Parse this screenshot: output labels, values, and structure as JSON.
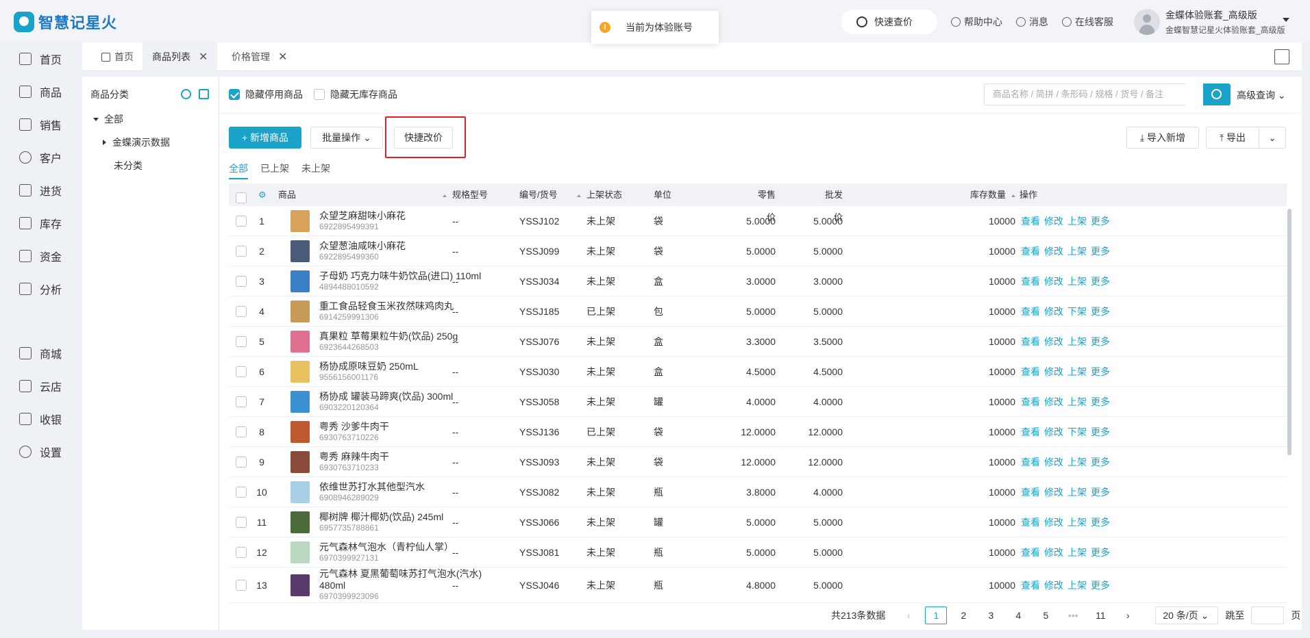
{
  "app": {
    "name": "智慧记星火"
  },
  "toast": {
    "text": "当前为体验账号",
    "icon": "warning-icon"
  },
  "topbar": {
    "quick_price": "快速查价",
    "help": "帮助中心",
    "messages": "消息",
    "service": "在线客服",
    "user_name": "金蝶体验账套_高级版",
    "user_sub": "金蝶智慧记星火体验账套_高级版"
  },
  "nav": [
    {
      "label": "首页",
      "icon": "home-icon"
    },
    {
      "label": "商品",
      "icon": "goods-icon"
    },
    {
      "label": "销售",
      "icon": "sales-icon"
    },
    {
      "label": "客户",
      "icon": "customer-icon"
    },
    {
      "label": "进货",
      "icon": "purchase-icon"
    },
    {
      "label": "库存",
      "icon": "inventory-icon"
    },
    {
      "label": "资金",
      "icon": "funds-icon"
    },
    {
      "label": "分析",
      "icon": "analysis-icon"
    },
    {
      "label": "商城",
      "icon": "mall-icon"
    },
    {
      "label": "云店",
      "icon": "cloud-store-icon"
    },
    {
      "label": "收银",
      "icon": "cashier-icon"
    },
    {
      "label": "设置",
      "icon": "settings-icon"
    }
  ],
  "tabs": [
    {
      "label": "首页"
    },
    {
      "label": "商品列表"
    },
    {
      "label": "价格管理"
    }
  ],
  "category": {
    "title": "商品分类",
    "all": "全部",
    "demo": "金蝶演示数据",
    "uncategorized": "未分类"
  },
  "filters": {
    "hide_disabled": "隐藏停用商品",
    "hide_no_stock": "隐藏无库存商品",
    "search_placeholder": "商品名称 / 简拼 / 条形码 / 规格 / 货号 / 备注",
    "advanced": "高级查询"
  },
  "toolbar": {
    "add": "+ 新增商品",
    "batch": "批量操作",
    "quick_edit": "快捷改价",
    "import": "导入新增",
    "export": "导出"
  },
  "subtabs": [
    "全部",
    "已上架",
    "未上架"
  ],
  "columns": {
    "product": "商品",
    "spec": "规格型号",
    "code": "编号/货号",
    "status": "上架状态",
    "unit": "单位",
    "retail": "零售价",
    "wholesale": "批发价",
    "stock": "库存数量",
    "ops": "操作"
  },
  "ops_labels": [
    "查看",
    "修改",
    "更多"
  ],
  "rows": [
    {
      "no": "1",
      "name": "众望芝麻甜味小麻花",
      "barcode": "6922895499391",
      "spec": "--",
      "code": "YSSJ102",
      "status": "未上架",
      "unit": "袋",
      "retail": "5.0000",
      "wholesale": "5.0000",
      "stock": "10000",
      "shelf_op": "上架",
      "color": "#d8a25a"
    },
    {
      "no": "2",
      "name": "众望葱油咸味小麻花",
      "barcode": "6922895499360",
      "spec": "--",
      "code": "YSSJ099",
      "status": "未上架",
      "unit": "袋",
      "retail": "5.0000",
      "wholesale": "5.0000",
      "stock": "10000",
      "shelf_op": "上架",
      "color": "#4a5a7a"
    },
    {
      "no": "3",
      "name": "子母奶 巧克力味牛奶饮品(进口) 110ml",
      "barcode": "4894488010592",
      "spec": "--",
      "code": "YSSJ034",
      "status": "未上架",
      "unit": "盒",
      "retail": "3.0000",
      "wholesale": "3.0000",
      "stock": "10000",
      "shelf_op": "上架",
      "color": "#3a7fc8"
    },
    {
      "no": "4",
      "name": "重工食品轻食玉米孜然味鸡肉丸",
      "barcode": "6914259991306",
      "spec": "--",
      "code": "YSSJ185",
      "status": "已上架",
      "unit": "包",
      "retail": "5.0000",
      "wholesale": "5.0000",
      "stock": "10000",
      "shelf_op": "下架",
      "color": "#c89a58"
    },
    {
      "no": "5",
      "name": "真果粒 草莓果粒牛奶(饮品) 250g",
      "barcode": "6923644268503",
      "spec": "--",
      "code": "YSSJ076",
      "status": "未上架",
      "unit": "盒",
      "retail": "3.3000",
      "wholesale": "3.5000",
      "stock": "10000",
      "shelf_op": "上架",
      "color": "#e07090"
    },
    {
      "no": "6",
      "name": "杨协成原味豆奶 250mL",
      "barcode": "9556156001176",
      "spec": "--",
      "code": "YSSJ030",
      "status": "未上架",
      "unit": "盒",
      "retail": "4.5000",
      "wholesale": "4.5000",
      "stock": "10000",
      "shelf_op": "上架",
      "color": "#e8c060"
    },
    {
      "no": "7",
      "name": "杨协成 罐装马蹄爽(饮品) 300ml",
      "barcode": "6903220120364",
      "spec": "--",
      "code": "YSSJ058",
      "status": "未上架",
      "unit": "罐",
      "retail": "4.0000",
      "wholesale": "4.0000",
      "stock": "10000",
      "shelf_op": "上架",
      "color": "#3a90d0"
    },
    {
      "no": "8",
      "name": "粤秀 沙爹牛肉干",
      "barcode": "6930763710226",
      "spec": "--",
      "code": "YSSJ136",
      "status": "已上架",
      "unit": "袋",
      "retail": "12.0000",
      "wholesale": "12.0000",
      "stock": "10000",
      "shelf_op": "下架",
      "color": "#c05830"
    },
    {
      "no": "9",
      "name": "粤秀 麻辣牛肉干",
      "barcode": "6930763710233",
      "spec": "--",
      "code": "YSSJ093",
      "status": "未上架",
      "unit": "袋",
      "retail": "12.0000",
      "wholesale": "12.0000",
      "stock": "10000",
      "shelf_op": "上架",
      "color": "#8a4a3a"
    },
    {
      "no": "10",
      "name": "依维世苏打水其他型汽水",
      "barcode": "6908946289029",
      "spec": "--",
      "code": "YSSJ082",
      "status": "未上架",
      "unit": "瓶",
      "retail": "3.8000",
      "wholesale": "4.0000",
      "stock": "10000",
      "shelf_op": "上架",
      "color": "#a8d0e8"
    },
    {
      "no": "11",
      "name": "椰树牌 椰汁椰奶(饮品) 245ml",
      "barcode": "6957735788861",
      "spec": "--",
      "code": "YSSJ066",
      "status": "未上架",
      "unit": "罐",
      "retail": "5.0000",
      "wholesale": "5.0000",
      "stock": "10000",
      "shelf_op": "上架",
      "color": "#4a6a3a"
    },
    {
      "no": "12",
      "name": "元气森林气泡水（青柠仙人掌）",
      "barcode": "6970399927131",
      "spec": "--",
      "code": "YSSJ081",
      "status": "未上架",
      "unit": "瓶",
      "retail": "5.0000",
      "wholesale": "5.0000",
      "stock": "10000",
      "shelf_op": "上架",
      "color": "#b8d8c0"
    },
    {
      "no": "13",
      "name": "元气森林 夏黑葡萄味苏打气泡水(汽水) 480ml",
      "barcode": "6970399923096",
      "spec": "--",
      "code": "YSSJ046",
      "status": "未上架",
      "unit": "瓶",
      "retail": "4.8000",
      "wholesale": "5.0000",
      "stock": "10000",
      "shelf_op": "上架",
      "color": "#5a3a6a"
    }
  ],
  "pager": {
    "total": "共213条数据",
    "pages": [
      "1",
      "2",
      "3",
      "4",
      "5"
    ],
    "ellipsis": "•••",
    "last": "11",
    "page_size": "20 条/页",
    "jump": "跳至",
    "page_unit": "页"
  }
}
